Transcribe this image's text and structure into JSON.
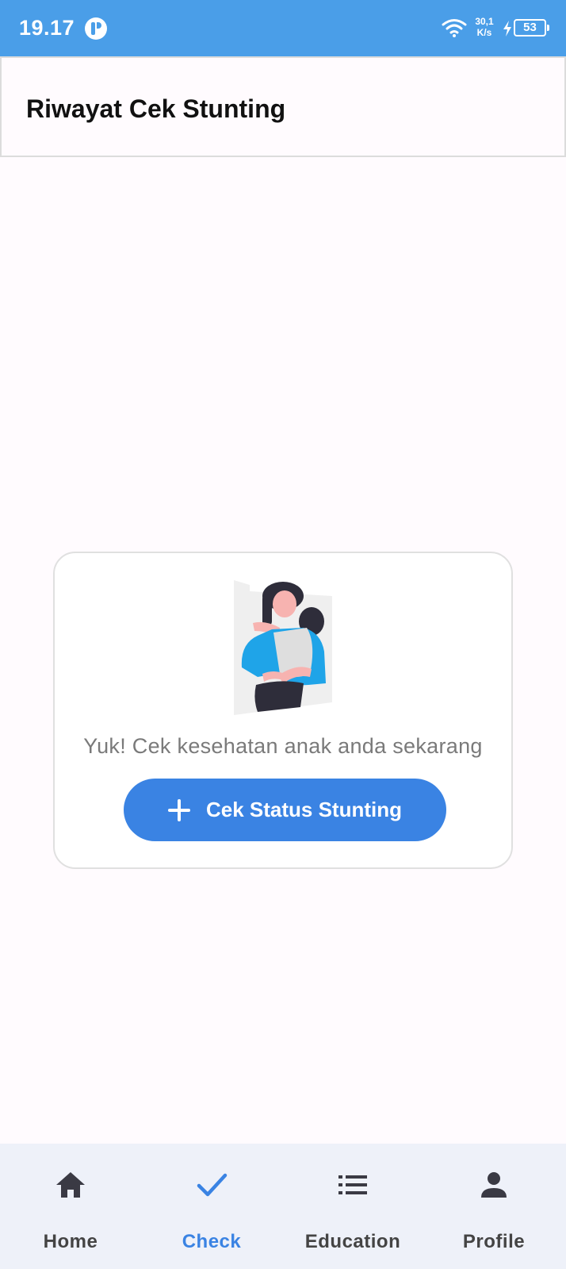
{
  "status_bar": {
    "time": "19.17",
    "network_speed_value": "30,1",
    "network_speed_unit": "K/s",
    "battery_level": "53"
  },
  "app_bar": {
    "title": "Riwayat Cek Stunting"
  },
  "empty_state": {
    "message": "Yuk! Cek kesehatan anak anda sekarang",
    "button_label": "Cek Status Stunting",
    "button_icon": "plus-icon"
  },
  "bottom_nav": {
    "active_index": 1,
    "items": [
      {
        "label": "Home",
        "icon": "home-icon"
      },
      {
        "label": "Check",
        "icon": "check-icon"
      },
      {
        "label": "Education",
        "icon": "list-icon"
      },
      {
        "label": "Profile",
        "icon": "person-icon"
      }
    ]
  },
  "colors": {
    "status_bar": "#4a9ee8",
    "accent": "#3a83e3",
    "background": "#fffbfe",
    "nav_background": "#eef1f9"
  }
}
